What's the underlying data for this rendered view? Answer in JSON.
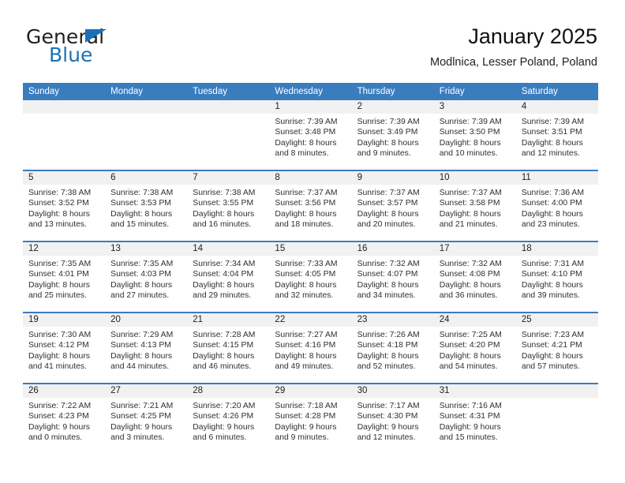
{
  "brand": {
    "word_one": "General",
    "word_two": "Blue",
    "triangle_icon": "triangle-icon"
  },
  "header": {
    "title": "January 2025",
    "subtitle": "Modlnica, Lesser Poland, Poland"
  },
  "colors": {
    "header_blue": "#3a7dbf",
    "brand_blue": "#1c70b8",
    "daynum_band": "#f1f1f1",
    "text": "#222222"
  },
  "weekday_headers": [
    "Sunday",
    "Monday",
    "Tuesday",
    "Wednesday",
    "Thursday",
    "Friday",
    "Saturday"
  ],
  "weeks": [
    [
      {
        "day": "",
        "sunrise": "",
        "sunset": "",
        "daylight_1": "",
        "daylight_2": ""
      },
      {
        "day": "",
        "sunrise": "",
        "sunset": "",
        "daylight_1": "",
        "daylight_2": ""
      },
      {
        "day": "",
        "sunrise": "",
        "sunset": "",
        "daylight_1": "",
        "daylight_2": ""
      },
      {
        "day": "1",
        "sunrise": "Sunrise: 7:39 AM",
        "sunset": "Sunset: 3:48 PM",
        "daylight_1": "Daylight: 8 hours",
        "daylight_2": "and 8 minutes."
      },
      {
        "day": "2",
        "sunrise": "Sunrise: 7:39 AM",
        "sunset": "Sunset: 3:49 PM",
        "daylight_1": "Daylight: 8 hours",
        "daylight_2": "and 9 minutes."
      },
      {
        "day": "3",
        "sunrise": "Sunrise: 7:39 AM",
        "sunset": "Sunset: 3:50 PM",
        "daylight_1": "Daylight: 8 hours",
        "daylight_2": "and 10 minutes."
      },
      {
        "day": "4",
        "sunrise": "Sunrise: 7:39 AM",
        "sunset": "Sunset: 3:51 PM",
        "daylight_1": "Daylight: 8 hours",
        "daylight_2": "and 12 minutes."
      }
    ],
    [
      {
        "day": "5",
        "sunrise": "Sunrise: 7:38 AM",
        "sunset": "Sunset: 3:52 PM",
        "daylight_1": "Daylight: 8 hours",
        "daylight_2": "and 13 minutes."
      },
      {
        "day": "6",
        "sunrise": "Sunrise: 7:38 AM",
        "sunset": "Sunset: 3:53 PM",
        "daylight_1": "Daylight: 8 hours",
        "daylight_2": "and 15 minutes."
      },
      {
        "day": "7",
        "sunrise": "Sunrise: 7:38 AM",
        "sunset": "Sunset: 3:55 PM",
        "daylight_1": "Daylight: 8 hours",
        "daylight_2": "and 16 minutes."
      },
      {
        "day": "8",
        "sunrise": "Sunrise: 7:37 AM",
        "sunset": "Sunset: 3:56 PM",
        "daylight_1": "Daylight: 8 hours",
        "daylight_2": "and 18 minutes."
      },
      {
        "day": "9",
        "sunrise": "Sunrise: 7:37 AM",
        "sunset": "Sunset: 3:57 PM",
        "daylight_1": "Daylight: 8 hours",
        "daylight_2": "and 20 minutes."
      },
      {
        "day": "10",
        "sunrise": "Sunrise: 7:37 AM",
        "sunset": "Sunset: 3:58 PM",
        "daylight_1": "Daylight: 8 hours",
        "daylight_2": "and 21 minutes."
      },
      {
        "day": "11",
        "sunrise": "Sunrise: 7:36 AM",
        "sunset": "Sunset: 4:00 PM",
        "daylight_1": "Daylight: 8 hours",
        "daylight_2": "and 23 minutes."
      }
    ],
    [
      {
        "day": "12",
        "sunrise": "Sunrise: 7:35 AM",
        "sunset": "Sunset: 4:01 PM",
        "daylight_1": "Daylight: 8 hours",
        "daylight_2": "and 25 minutes."
      },
      {
        "day": "13",
        "sunrise": "Sunrise: 7:35 AM",
        "sunset": "Sunset: 4:03 PM",
        "daylight_1": "Daylight: 8 hours",
        "daylight_2": "and 27 minutes."
      },
      {
        "day": "14",
        "sunrise": "Sunrise: 7:34 AM",
        "sunset": "Sunset: 4:04 PM",
        "daylight_1": "Daylight: 8 hours",
        "daylight_2": "and 29 minutes."
      },
      {
        "day": "15",
        "sunrise": "Sunrise: 7:33 AM",
        "sunset": "Sunset: 4:05 PM",
        "daylight_1": "Daylight: 8 hours",
        "daylight_2": "and 32 minutes."
      },
      {
        "day": "16",
        "sunrise": "Sunrise: 7:32 AM",
        "sunset": "Sunset: 4:07 PM",
        "daylight_1": "Daylight: 8 hours",
        "daylight_2": "and 34 minutes."
      },
      {
        "day": "17",
        "sunrise": "Sunrise: 7:32 AM",
        "sunset": "Sunset: 4:08 PM",
        "daylight_1": "Daylight: 8 hours",
        "daylight_2": "and 36 minutes."
      },
      {
        "day": "18",
        "sunrise": "Sunrise: 7:31 AM",
        "sunset": "Sunset: 4:10 PM",
        "daylight_1": "Daylight: 8 hours",
        "daylight_2": "and 39 minutes."
      }
    ],
    [
      {
        "day": "19",
        "sunrise": "Sunrise: 7:30 AM",
        "sunset": "Sunset: 4:12 PM",
        "daylight_1": "Daylight: 8 hours",
        "daylight_2": "and 41 minutes."
      },
      {
        "day": "20",
        "sunrise": "Sunrise: 7:29 AM",
        "sunset": "Sunset: 4:13 PM",
        "daylight_1": "Daylight: 8 hours",
        "daylight_2": "and 44 minutes."
      },
      {
        "day": "21",
        "sunrise": "Sunrise: 7:28 AM",
        "sunset": "Sunset: 4:15 PM",
        "daylight_1": "Daylight: 8 hours",
        "daylight_2": "and 46 minutes."
      },
      {
        "day": "22",
        "sunrise": "Sunrise: 7:27 AM",
        "sunset": "Sunset: 4:16 PM",
        "daylight_1": "Daylight: 8 hours",
        "daylight_2": "and 49 minutes."
      },
      {
        "day": "23",
        "sunrise": "Sunrise: 7:26 AM",
        "sunset": "Sunset: 4:18 PM",
        "daylight_1": "Daylight: 8 hours",
        "daylight_2": "and 52 minutes."
      },
      {
        "day": "24",
        "sunrise": "Sunrise: 7:25 AM",
        "sunset": "Sunset: 4:20 PM",
        "daylight_1": "Daylight: 8 hours",
        "daylight_2": "and 54 minutes."
      },
      {
        "day": "25",
        "sunrise": "Sunrise: 7:23 AM",
        "sunset": "Sunset: 4:21 PM",
        "daylight_1": "Daylight: 8 hours",
        "daylight_2": "and 57 minutes."
      }
    ],
    [
      {
        "day": "26",
        "sunrise": "Sunrise: 7:22 AM",
        "sunset": "Sunset: 4:23 PM",
        "daylight_1": "Daylight: 9 hours",
        "daylight_2": "and 0 minutes."
      },
      {
        "day": "27",
        "sunrise": "Sunrise: 7:21 AM",
        "sunset": "Sunset: 4:25 PM",
        "daylight_1": "Daylight: 9 hours",
        "daylight_2": "and 3 minutes."
      },
      {
        "day": "28",
        "sunrise": "Sunrise: 7:20 AM",
        "sunset": "Sunset: 4:26 PM",
        "daylight_1": "Daylight: 9 hours",
        "daylight_2": "and 6 minutes."
      },
      {
        "day": "29",
        "sunrise": "Sunrise: 7:18 AM",
        "sunset": "Sunset: 4:28 PM",
        "daylight_1": "Daylight: 9 hours",
        "daylight_2": "and 9 minutes."
      },
      {
        "day": "30",
        "sunrise": "Sunrise: 7:17 AM",
        "sunset": "Sunset: 4:30 PM",
        "daylight_1": "Daylight: 9 hours",
        "daylight_2": "and 12 minutes."
      },
      {
        "day": "31",
        "sunrise": "Sunrise: 7:16 AM",
        "sunset": "Sunset: 4:31 PM",
        "daylight_1": "Daylight: 9 hours",
        "daylight_2": "and 15 minutes."
      },
      {
        "day": "",
        "sunrise": "",
        "sunset": "",
        "daylight_1": "",
        "daylight_2": ""
      }
    ]
  ]
}
